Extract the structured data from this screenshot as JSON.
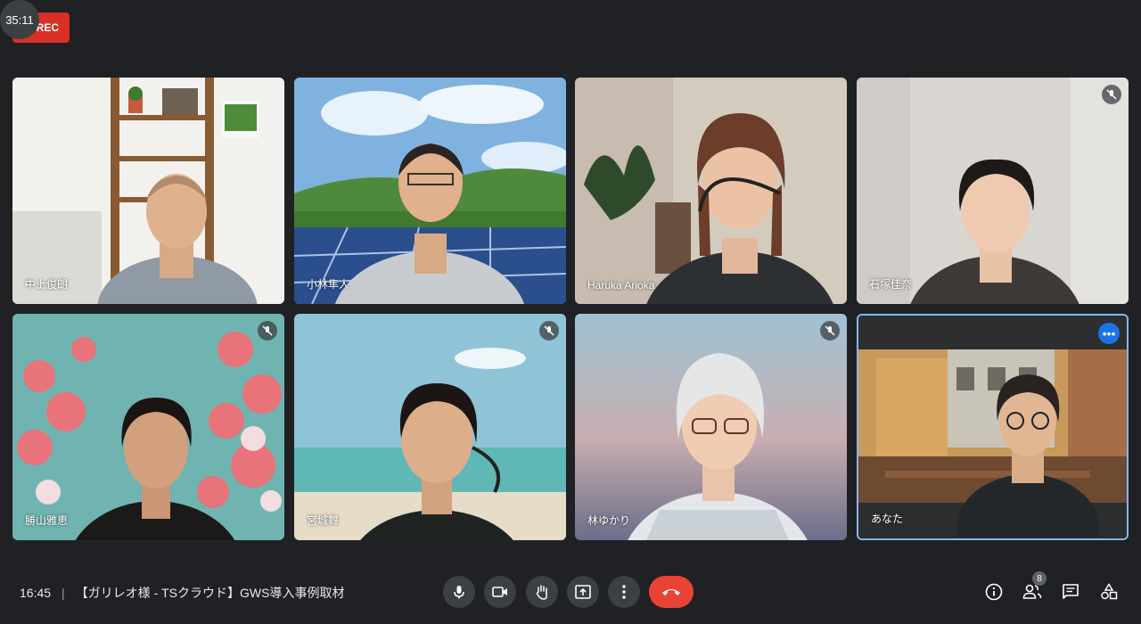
{
  "recording": {
    "label": "REC",
    "timer": "35:11"
  },
  "participants": [
    {
      "name": "中上俊朗",
      "muted": false
    },
    {
      "name": "小林隼人",
      "muted": false
    },
    {
      "name": "Haruka Arioka",
      "muted": false
    },
    {
      "name": "石塚佳奈",
      "muted": true
    },
    {
      "name": "勝山雅恵",
      "muted": true
    },
    {
      "name": "宮城舞",
      "muted": true
    },
    {
      "name": "林ゆかり",
      "muted": true
    },
    {
      "name": "あなた",
      "muted": false
    }
  ],
  "meeting": {
    "time": "16:45",
    "separator": "|",
    "title": "【ガリレオ様 - TSクラウド】GWS導入事例取材"
  },
  "controls": [
    "mic-icon",
    "camera-icon",
    "raise-hand-icon",
    "present-icon",
    "more-options-icon",
    "end-call-icon"
  ],
  "right_panel": {
    "people_count": "8"
  },
  "colors": {
    "background": "#202124",
    "rec": "#d93025",
    "end_call": "#ea4335",
    "accent": "#1a73e8"
  }
}
